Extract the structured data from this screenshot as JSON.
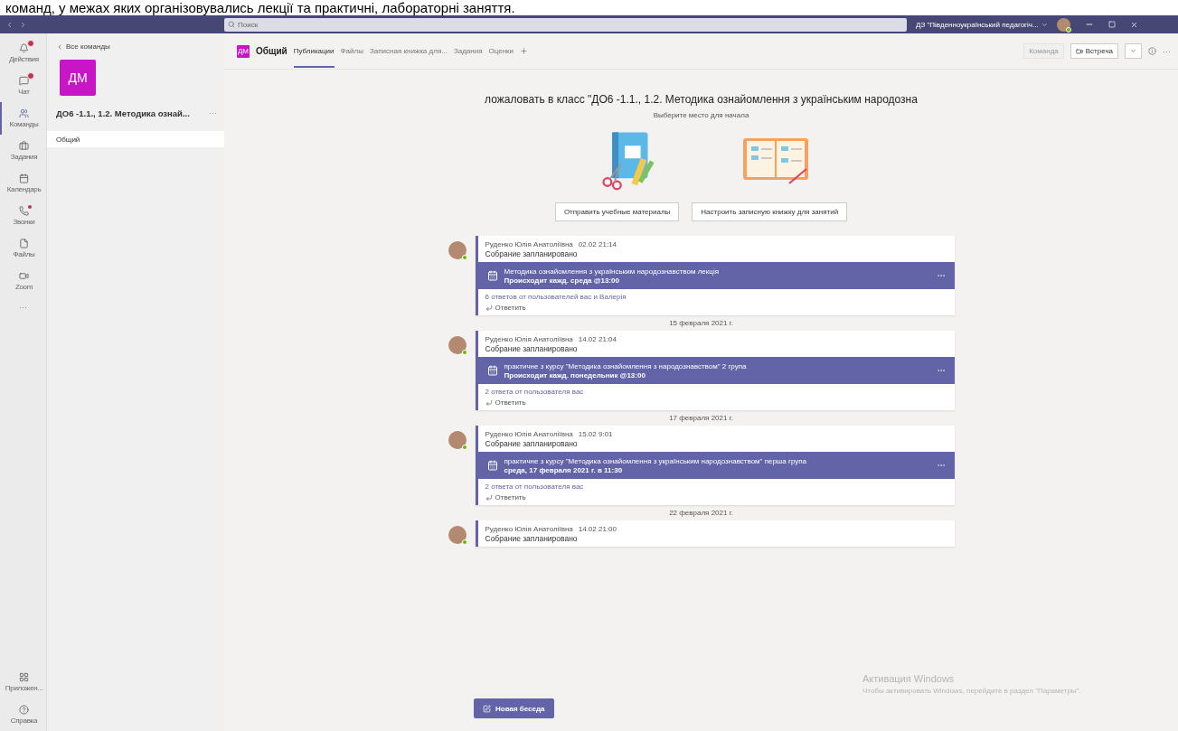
{
  "document_text": "команд, у межах яких організовувались лекції та практичні, лабораторні заняття.",
  "titlebar": {
    "search_placeholder": "Поиск",
    "org": "ДЗ \"Південноукраїнський педагогіч..."
  },
  "rail": [
    {
      "label": "Действия",
      "selected": false,
      "badge": true,
      "dot": false
    },
    {
      "label": "Чат",
      "selected": false,
      "badge": true,
      "dot": false
    },
    {
      "label": "Команды",
      "selected": true,
      "badge": false,
      "dot": false
    },
    {
      "label": "Задания",
      "selected": false,
      "badge": false,
      "dot": false
    },
    {
      "label": "Календарь",
      "selected": false,
      "badge": false,
      "dot": false
    },
    {
      "label": "Звонки",
      "selected": false,
      "badge": false,
      "dot": true
    },
    {
      "label": "Файлы",
      "selected": false,
      "badge": false,
      "dot": false
    },
    {
      "label": "Zoom",
      "selected": false,
      "badge": false,
      "dot": false
    }
  ],
  "rail_more": "···",
  "rail_bottom": [
    {
      "label": "Приложен..."
    },
    {
      "label": "Справка"
    }
  ],
  "team_panel": {
    "back_link": "Все команды",
    "team_initials": "ДМ",
    "team_name": "ДО6 -1.1., 1.2. Методика ознай...",
    "more": "···",
    "channels": [
      {
        "name": "Общий",
        "selected": true
      }
    ]
  },
  "channel_header": {
    "initials": "ДМ",
    "name": "Общий",
    "tabs": [
      {
        "label": "Публикации",
        "selected": true
      },
      {
        "label": "Файлы",
        "selected": false
      },
      {
        "label": "Записная книжка для...",
        "selected": false
      },
      {
        "label": "Задания",
        "selected": false
      },
      {
        "label": "Оценки",
        "selected": false
      }
    ],
    "team_button": "Команда",
    "meet_button": "Встреча",
    "more": "···"
  },
  "welcome": {
    "title": "ложаловать в класс \"ДО6 -1.1., 1.2. Методика ознайомлення з українським народозна",
    "subtitle": "Выберите место для начала",
    "buttons": [
      "Отправить учебные материалы",
      "Настроить записную книжку для занятий"
    ]
  },
  "feed": [
    {
      "kind": "post",
      "author": "Руденко Юлія Анатоліївна",
      "time": "02.02 21:14",
      "status": "Собрание запланировано",
      "event_title": "Методика ознайомлення з українським народознавством лекція",
      "event_detail": "Происходит кажд. среда @13:00",
      "replies": "6 ответов от пользователей вас и Валерія",
      "reply": "Ответить"
    },
    {
      "kind": "date",
      "text": "15 февраля 2021 г."
    },
    {
      "kind": "post",
      "author": "Руденко Юлія Анатоліївна",
      "time": "14.02 21:04",
      "status": "Собрание запланировано",
      "event_title": "практичне з курсу \"Методика ознайомлення з народознавством\" 2 група",
      "event_detail": "Происходит кажд. понедельник @13:00",
      "replies": "2 ответа от пользователя вас",
      "reply": "Ответить"
    },
    {
      "kind": "date",
      "text": "17 февраля 2021 г."
    },
    {
      "kind": "post",
      "author": "Руденко Юлія Анатоліївна",
      "time": "15.02 9:01",
      "status": "Собрание запланировано",
      "event_title": "практичне з курсу \"Методика ознайомлення з українським народознавством\" перша група",
      "event_detail": "среда, 17 февраля 2021 г. в 11:30",
      "replies": "2 ответа от пользователя вас",
      "reply": "Ответить"
    },
    {
      "kind": "date",
      "text": "22 февраля 2021 г."
    },
    {
      "kind": "post",
      "author": "Руденко Юлія Анатоліївна",
      "time": "14.02 21:00",
      "status": "Собрание запланировано"
    }
  ],
  "new_chat_button": "Новая беседа",
  "activation_notice": {
    "title": "Активация Windows",
    "text": "Чтобы активировать Windows, перейдите в раздел \"Параметры\"."
  }
}
